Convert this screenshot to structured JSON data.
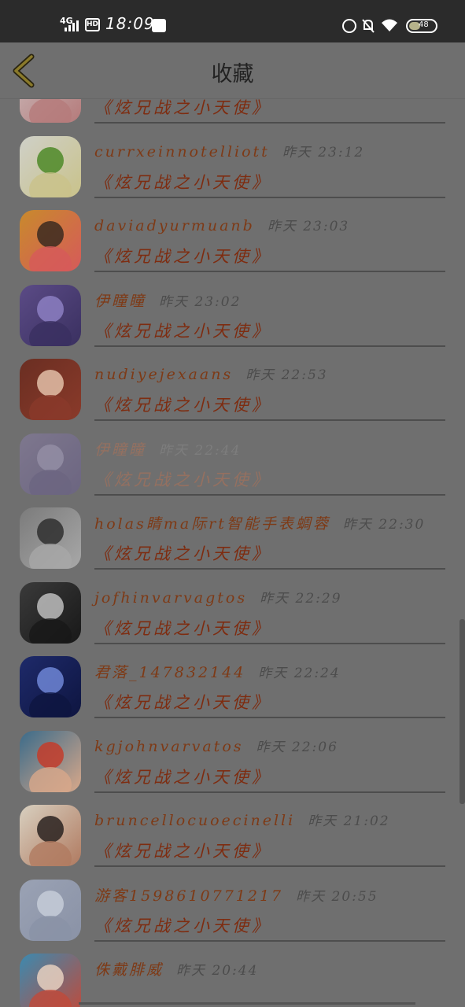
{
  "status": {
    "network": "4G",
    "hd": "HD",
    "time": "18:09",
    "battery": "48"
  },
  "header": {
    "title": "收藏"
  },
  "items": [
    {
      "name": "",
      "time": "",
      "quote": "《炫兄战之小天使》",
      "avatar_colors": [
        "#c9b9b9",
        "#eee",
        "#b57a7a"
      ]
    },
    {
      "name": "currxeinnotelliott",
      "time": "昨天 23:12",
      "quote": "《炫兄战之小天使》",
      "avatar_colors": [
        "#cfd0c8",
        "#4e8a28",
        "#c9c28a"
      ]
    },
    {
      "name": "daviadyurmuanb",
      "time": "昨天 23:03",
      "quote": "《炫兄战之小天使》",
      "avatar_colors": [
        "#c88a2c",
        "#3b2a20",
        "#d65a5a"
      ]
    },
    {
      "name": "伊瞳瞳",
      "time": "昨天 23:02",
      "quote": "《炫兄战之小天使》",
      "avatar_colors": [
        "#5b4b86",
        "#8c7fc2",
        "#3a3060"
      ]
    },
    {
      "name": "nudiyejexaans",
      "time": "昨天 22:53",
      "quote": "《炫兄战之小天使》",
      "avatar_colors": [
        "#6a2e22",
        "#e3c0a8",
        "#8a3a2a"
      ]
    },
    {
      "name": "伊瞳瞳",
      "time": "昨天 22:44",
      "quote": "《炫兄战之小天使》",
      "faded": true,
      "avatar_colors": [
        "#8b7fa8",
        "#b2a8d0",
        "#6a5e90"
      ]
    },
    {
      "name": "holas睛ma际rt智能手表蜩蓉",
      "time": "昨天 22:30",
      "quote": "《炫兄战之小天使》",
      "avatar_colors": [
        "#7b7b7b",
        "#2f2f2f",
        "#a8a8a8"
      ]
    },
    {
      "name": "jofhinvarvagtos",
      "time": "昨天 22:29",
      "quote": "《炫兄战之小天使》",
      "avatar_colors": [
        "#3a3a3a",
        "#bdbdbd",
        "#181818"
      ]
    },
    {
      "name": "君落_147832144",
      "time": "昨天 22:24",
      "quote": "《炫兄战之小天使》",
      "avatar_colors": [
        "#1e2a6a",
        "#6f86d6",
        "#0e1540"
      ]
    },
    {
      "name": "kgjohnvarvatos",
      "time": "昨天 22:06",
      "quote": "《炫兄战之小天使》",
      "avatar_colors": [
        "#3b6b8a",
        "#c33c2a",
        "#d8a88a"
      ]
    },
    {
      "name": "bruncellocuoecinelli",
      "time": "昨天 21:02",
      "quote": "《炫兄战之小天使》",
      "avatar_colors": [
        "#d8d0c0",
        "#2a2220",
        "#b07a60"
      ]
    },
    {
      "name": "游客1598610771217",
      "time": "昨天 20:55",
      "quote": "《炫兄战之小天使》",
      "avatar_colors": [
        "#9aa2b4",
        "#c6ccd8",
        "#8a92a6"
      ]
    },
    {
      "name": "侏戴腓威",
      "time": "昨天 20:44",
      "quote": "",
      "avatar_colors": [
        "#3b8ab0",
        "#e6d0c0",
        "#c04a3a"
      ]
    }
  ]
}
